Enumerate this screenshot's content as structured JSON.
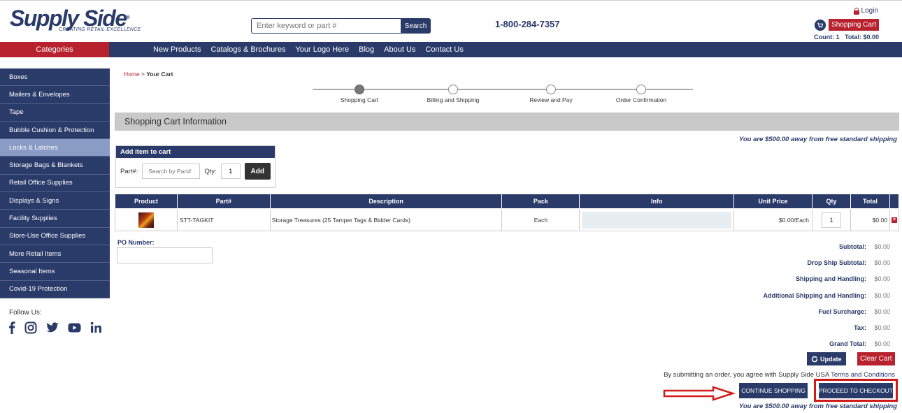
{
  "header": {
    "logo_text": "Supply Side",
    "logo_reg": "®",
    "logo_tagline": "CREATING RETAIL EXCELLENCE",
    "search_placeholder": "Enter keyword or part #",
    "search_button": "Search",
    "phone": "1-800-284-7357",
    "login": "Login",
    "cart_button": "Shopping Cart",
    "cart_icon": "shopping-cart-icon",
    "cart_count_label": "Count:",
    "cart_count": "1",
    "cart_total_label": "Total:",
    "cart_total": "$0.00"
  },
  "nav": {
    "categories": "Categories",
    "links": [
      "New Products",
      "Catalogs & Brochures",
      "Your Logo Here",
      "Blog",
      "About Us",
      "Contact Us"
    ]
  },
  "sidebar": {
    "items": [
      {
        "label": "Boxes"
      },
      {
        "label": "Mailers & Envelopes"
      },
      {
        "label": "Tape"
      },
      {
        "label": "Bubble Cushion & Protection"
      },
      {
        "label": "Locks & Latches",
        "active": true
      },
      {
        "label": "Storage Bags & Blankets"
      },
      {
        "label": "Retail Office Supplies"
      },
      {
        "label": "Displays & Signs"
      },
      {
        "label": "Facility Supplies"
      },
      {
        "label": "Store-Use Office Supplies"
      },
      {
        "label": "More Retail Items"
      },
      {
        "label": "Seasonal Items"
      },
      {
        "label": "Covid-19 Protection"
      }
    ],
    "follow_label": "Follow Us:",
    "socials": [
      "facebook-icon",
      "instagram-icon",
      "twitter-icon",
      "youtube-icon",
      "linkedin-icon"
    ]
  },
  "breadcrumb": {
    "home": "Home",
    "separator": " > ",
    "current": "Your Cart"
  },
  "steps": [
    {
      "label": "Shopping Cart",
      "active": true
    },
    {
      "label": "Billing and Shipping",
      "active": false
    },
    {
      "label": "Review and Pay",
      "active": false
    },
    {
      "label": "Order Confirmation",
      "active": false
    }
  ],
  "cart_info_title": "Shopping Cart Information",
  "free_shipping_msg": "You are $500.00 away from free standard shipping",
  "add_item": {
    "title": "Add item to cart",
    "part_label": "Part#:",
    "part_placeholder": "Search by Part#",
    "qty_label": "Qty:",
    "qty_value": "1",
    "add_button": "Add"
  },
  "table": {
    "headers": [
      "Product",
      "Part#",
      "Description",
      "Pack",
      "Info",
      "Unit Price",
      "Qty",
      "Total"
    ],
    "rows": [
      {
        "part": "STT-TAGKIT",
        "description": "Storage Treasures (25 Tamper Tags & Bidder Cards)",
        "pack": "Each",
        "info": "",
        "unit_price": "$0.00/Each",
        "qty": "1",
        "total": "$0.00"
      }
    ]
  },
  "po": {
    "label": "PO Number:",
    "value": ""
  },
  "totals": [
    {
      "label": "Subtotal:",
      "value": "$0.00"
    },
    {
      "label": "Drop Ship Subtotal:",
      "value": "$0.00"
    },
    {
      "label": "Shipping and Handling:",
      "value": "$0.00"
    },
    {
      "label": "Additional Shipping and Handling:",
      "value": "$0.00"
    },
    {
      "label": "Fuel Surcharge:",
      "value": "$0.00"
    },
    {
      "label": "Tax:",
      "value": "$0.00"
    },
    {
      "label": "Grand Total:",
      "value": "$0.00"
    }
  ],
  "actions": {
    "update": "Update",
    "clear_cart": "Clear Cart",
    "terms_prefix": "By submitting an order, you agree with Supply Side USA ",
    "terms_link": "Terms and Conditions",
    "continue_shopping": "CONTINUE SHOPPING",
    "proceed_checkout": "PROCEED TO CHECKOUT"
  },
  "colors": {
    "navy": "#2a3b6a",
    "red": "#b8222e",
    "active_sidebar": "#8a9cc5",
    "annotation_red": "#d11a1a"
  }
}
